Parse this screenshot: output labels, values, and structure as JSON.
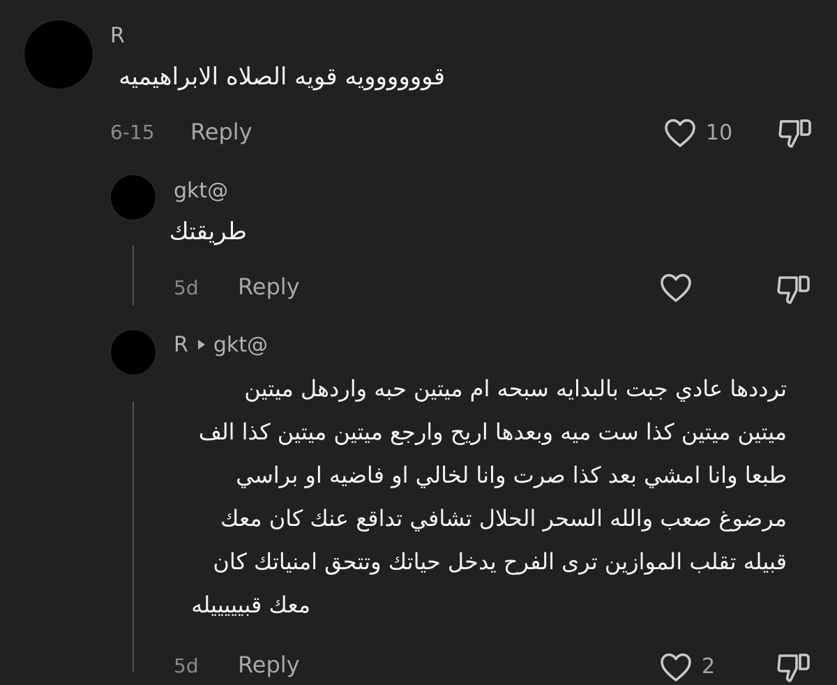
{
  "comments": [
    {
      "username": "R",
      "text": "قوووووويه قويه الصلاه الابراهيميه",
      "time": "6-15",
      "reply_label": "Reply",
      "likes": "10"
    }
  ],
  "replies": [
    {
      "username": "gkt@",
      "text": "طريقتك",
      "time": "5d",
      "reply_label": "Reply"
    },
    {
      "username": "R",
      "reply_to": "gkt@",
      "lines": [
        "ترددها عادي جبت بالبدايه سبحه ام ميتين حبه واردهل ميتين",
        "ميتين ميتين كذا ست ميه وبعدها اريح وارجع ميتين ميتين كذا الف",
        "طبعا وانا امشي بعد كذا صرت وانا لخالي او فاضيه او براسي",
        "مرضوغ صعب والله السحر الحلال تشافي تداقع عنك كان معك",
        "قبيله تقلب الموازين ترى الفرح يدخل حياتك وتتحق امنياتك كان",
        "معك قبيييييله"
      ],
      "time": "5d",
      "reply_label": "Reply",
      "likes": "2"
    }
  ],
  "icons": {
    "like": "heart-outline-icon",
    "dislike": "thumbs-down-outline-icon",
    "reply_arrow": "triangle-right-icon"
  }
}
